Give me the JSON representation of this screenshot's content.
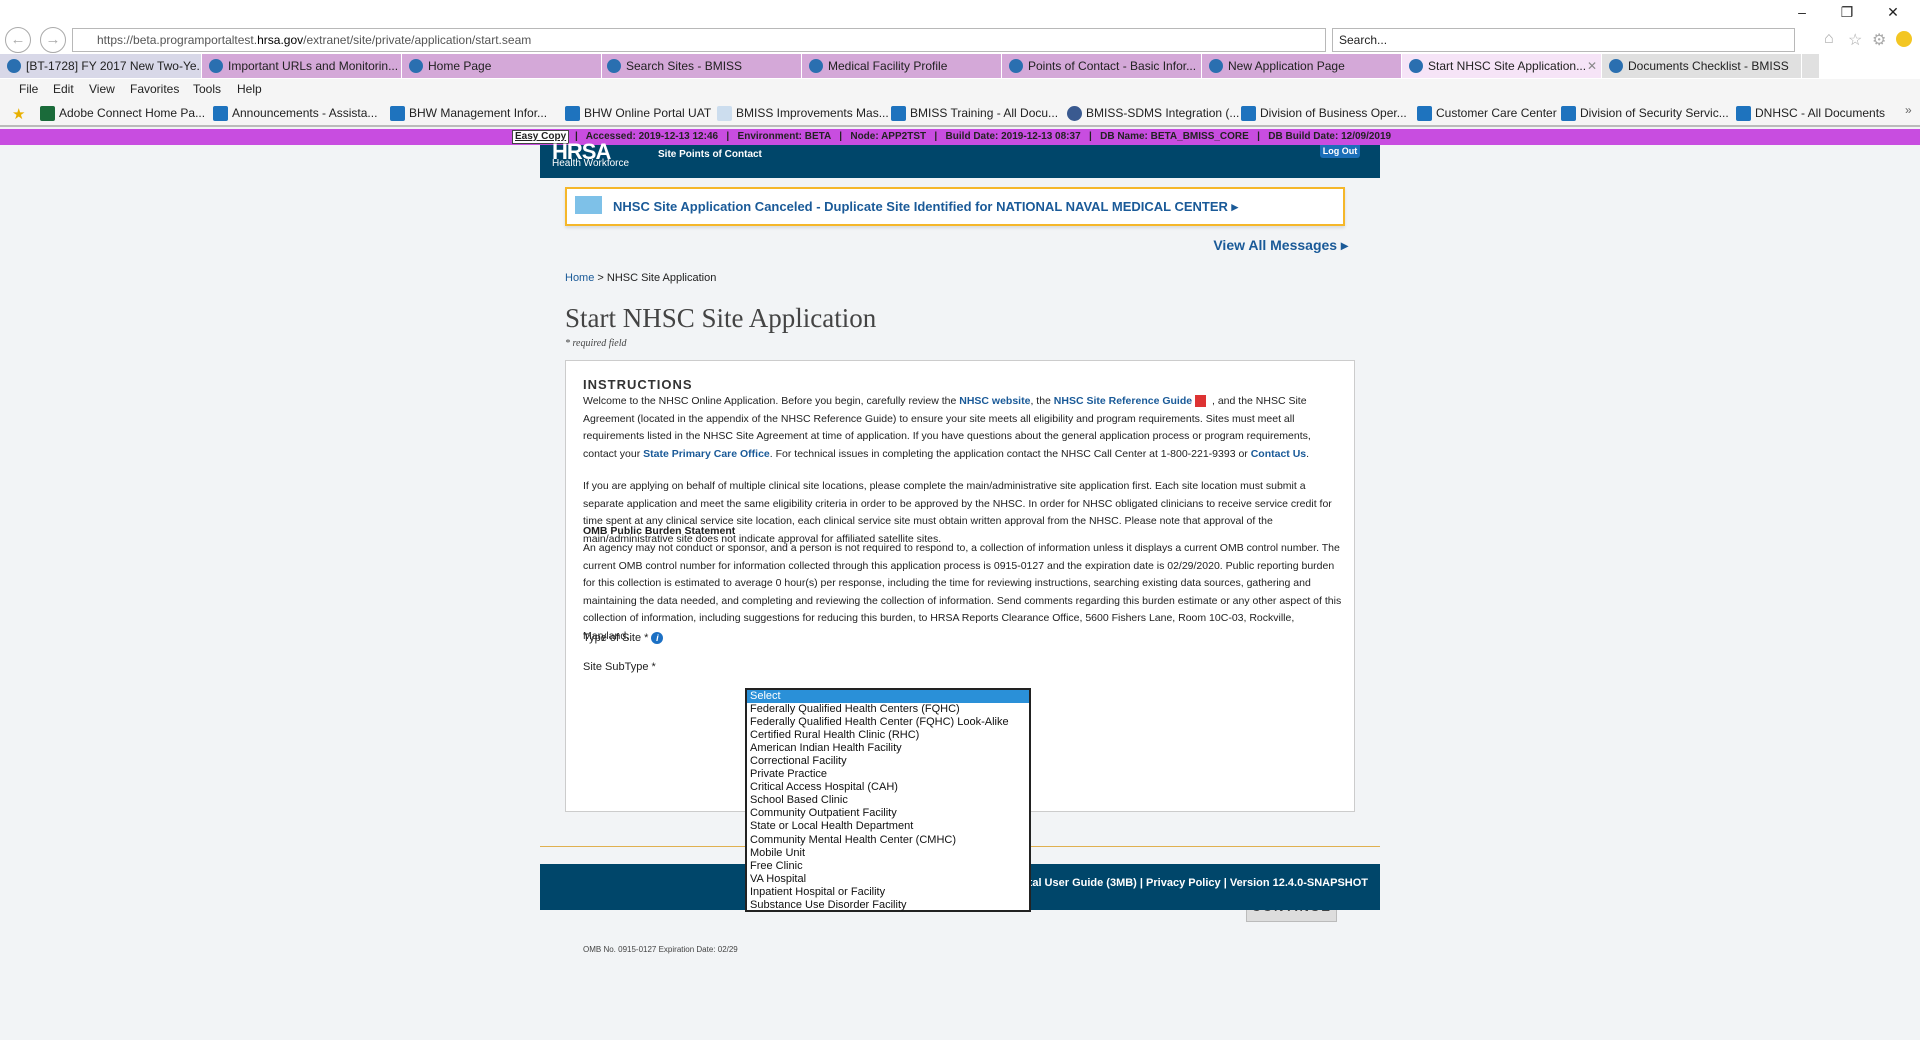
{
  "browser": {
    "url_prefix": "https://beta.programportaltest.",
    "url_domain": "hrsa.gov",
    "url_path": "/extranet/site/private/application/start.seam",
    "search_placeholder": "Search...",
    "window_controls": {
      "minimize": "–",
      "restore": "❐",
      "close": "✕"
    },
    "tabs": [
      {
        "label": "[BT-1728] FY 2017 New Two-Ye..."
      },
      {
        "label": "Important URLs and Monitorin..."
      },
      {
        "label": "Home Page"
      },
      {
        "label": "Search Sites - BMISS"
      },
      {
        "label": "Medical Facility Profile"
      },
      {
        "label": "Points of Contact - Basic Infor..."
      },
      {
        "label": "New Application Page"
      },
      {
        "label": "Start NHSC Site Application..."
      },
      {
        "label": "Documents Checklist - BMISS"
      }
    ],
    "active_tab": "Start NHSC Site Application...",
    "menu": [
      "File",
      "Edit",
      "View",
      "Favorites",
      "Tools",
      "Help"
    ],
    "favorites": [
      "Adobe Connect Home Pa...",
      "Announcements - Assista...",
      "BHW Management Infor...",
      "BHW Online Portal UAT",
      "BMISS Improvements Mas...",
      "BMISS Training - All Docu...",
      "BMISS-SDMS Integration (...",
      "Division of Business Oper...",
      "Customer Care Center",
      "Division of Security Servic...",
      "DNHSC - All Documents"
    ],
    "more": "»"
  },
  "envstrip": {
    "easy_copy": "Easy Copy",
    "info": "|   Accessed: 2019-12-13 12:46   |   Environment: BETA   |   Node: APP2TST   |   Build Date: 2019-12-13 08:37   |   DB Name: BETA_BMISS_CORE   |   DB Build Date: 12/09/2019"
  },
  "header": {
    "logo": "HRSA",
    "logo_sub": "Health Workforce",
    "title": "Site Points of Contact",
    "logout": "Log Out"
  },
  "message": {
    "text": "NHSC Site Application Canceled - Duplicate Site Identified for NATIONAL NAVAL MEDICAL CENTER ▸",
    "view_all": "View All Messages ▸"
  },
  "breadcrumb": {
    "home": "Home",
    "sep": " > ",
    "current": "NHSC Site Application"
  },
  "page": {
    "title": "Start NHSC Site Application",
    "required": "* required field"
  },
  "instructions": {
    "heading": "INSTRUCTIONS",
    "p1": {
      "a": "Welcome to the NHSC Online Application. Before you begin, carefully review the ",
      "link1": "NHSC website",
      "b": ", the ",
      "link2": "NHSC Site Reference Guide",
      "c": " , and the NHSC Site Agreement (located in the appendix of the NHSC Reference Guide) to ensure your site meets all eligibility and program requirements. Sites must meet all requirements listed in the NHSC Site Agreement at time of application. If you have questions about the general application process or program requirements, contact your ",
      "link3": "State Primary Care Office",
      "d": ". For technical issues in completing the application contact the NHSC Call Center at 1-800-221-9393 or ",
      "link4": "Contact Us",
      "e": "."
    },
    "p2": "If you are applying on behalf of multiple clinical site locations, please complete the main/administrative site application first. Each site location must submit a separate application and meet the same eligibility criteria in order to be approved by the NHSC. In order for NHSC obligated clinicians to receive service credit for time spent at any clinical service site location, each clinical service site must obtain written approval from the NHSC. Please note that approval of the main/administrative site does not indicate approval for affiliated satellite sites.",
    "omb_heading": "OMB Public Burden Statement",
    "omb_text": "An agency may not conduct or sponsor, and a person is not required to respond to, a collection of information unless it displays a current OMB control number. The current OMB control number for information collected through this application process is 0915-0127 and the expiration date is 02/29/2020. Public reporting burden for this collection is estimated to average 0 hour(s) per response, including the time for reviewing instructions, searching existing data sources, gathering and maintaining the data needed, and completing and reviewing the collection of information. Send comments regarding this burden estimate or any other aspect of this collection of information, including suggestions for reducing this burden, to HRSA Reports Clearance Office, 5600 Fishers Lane, Room 10C-03, Rockville, Maryland."
  },
  "form": {
    "type_label": "Type of Site *",
    "subtype_label": "Site SubType *",
    "info_icon": "i",
    "continue": "CONTINUE",
    "omb_no": "OMB No. 0915-0127 Expiration Date: 02/29",
    "type_options": [
      "Select",
      "Federally Qualified Health Centers (FQHC)",
      "Federally Qualified Health Center (FQHC) Look-Alike",
      "Certified Rural Health Clinic (RHC)",
      "American Indian Health Facility",
      "Correctional Facility",
      "Private Practice",
      "Critical Access Hospital (CAH)",
      "School Based Clinic",
      "Community Outpatient Facility",
      "State or Local Health Department",
      "Community Mental Health Center (CMHC)",
      "Mobile Unit",
      "Free Clinic",
      "VA Hospital",
      "Inpatient Hospital or Facility",
      "Substance Use Disorder Facility"
    ],
    "selected": "Select"
  },
  "footer": {
    "text": "Portal User Guide (3MB) | Privacy Policy | Version 12.4.0-SNAPSHOT"
  },
  "colors": {
    "header": "#00466a",
    "strip": "#c84de0",
    "accent": "#1a5a98",
    "message_border": "#f5b72a",
    "selected_option": "#2a90d8"
  }
}
